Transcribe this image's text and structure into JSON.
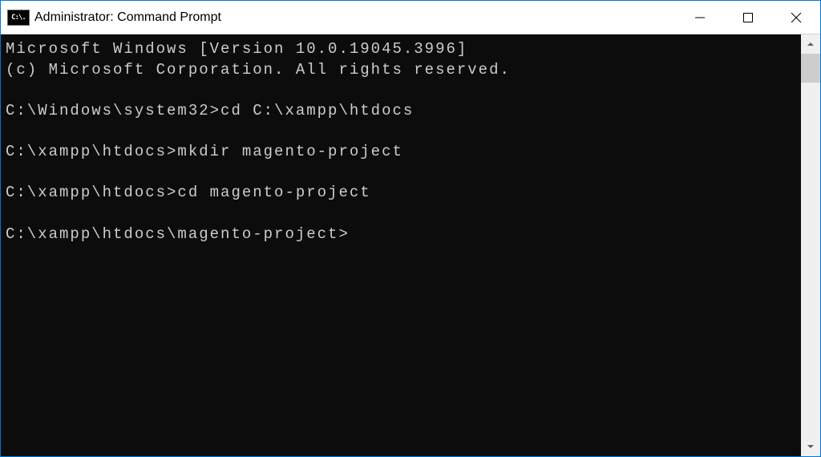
{
  "window": {
    "title": "Administrator: Command Prompt",
    "icon_text": "C:\\."
  },
  "console": {
    "lines": [
      "Microsoft Windows [Version 10.0.19045.3996]",
      "(c) Microsoft Corporation. All rights reserved.",
      "",
      "C:\\Windows\\system32>cd C:\\xampp\\htdocs",
      "",
      "C:\\xampp\\htdocs>mkdir magento-project",
      "",
      "C:\\xampp\\htdocs>cd magento-project",
      "",
      "C:\\xampp\\htdocs\\magento-project>"
    ]
  }
}
